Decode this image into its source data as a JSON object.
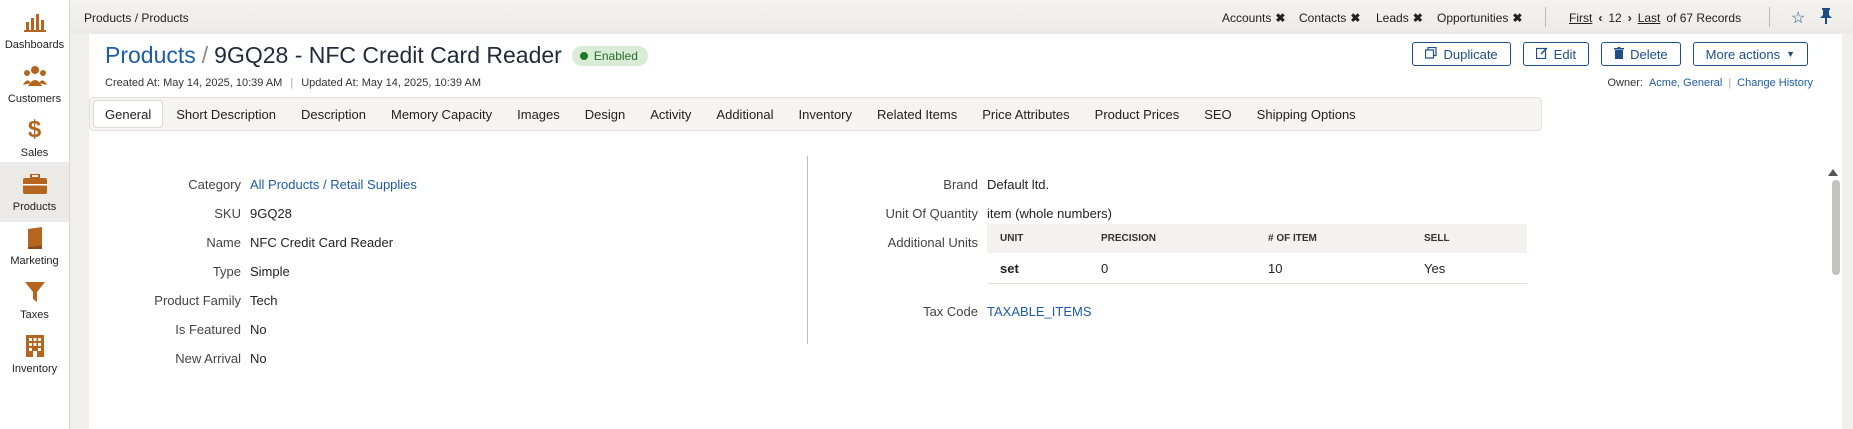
{
  "sidebar": {
    "items": [
      {
        "label": "Dashboards",
        "icon": "bar-chart-icon"
      },
      {
        "label": "Customers",
        "icon": "users-icon"
      },
      {
        "label": "Sales",
        "icon": "dollar-icon"
      },
      {
        "label": "Products",
        "icon": "briefcase-icon"
      },
      {
        "label": "Marketing",
        "icon": "book-icon"
      },
      {
        "label": "Taxes",
        "icon": "filter-icon"
      },
      {
        "label": "Inventory",
        "icon": "building-icon"
      }
    ]
  },
  "topbar": {
    "breadcrumb": "Products / Products",
    "pinned_tabs": [
      "Accounts",
      "Contacts",
      "Leads",
      "Opportunities"
    ],
    "pager": {
      "first": "First",
      "current": "12",
      "last": "Last",
      "total": "of 67 Records"
    }
  },
  "header": {
    "title_link": "Products",
    "title_sep": "/",
    "title": "9GQ28 - NFC Credit Card Reader",
    "status": "Enabled",
    "created": "Created At: May 14, 2025, 10:39 AM",
    "updated": "Updated At: May 14, 2025, 10:39 AM",
    "owner_label": "Owner:",
    "owner_value": "Acme, General",
    "change_history": "Change History"
  },
  "actions": {
    "duplicate": "Duplicate",
    "edit": "Edit",
    "delete": "Delete",
    "more": "More actions"
  },
  "tabs": [
    "General",
    "Short Description",
    "Description",
    "Memory Capacity",
    "Images",
    "Design",
    "Activity",
    "Additional",
    "Inventory",
    "Related Items",
    "Price Attributes",
    "Product Prices",
    "SEO",
    "Shipping Options"
  ],
  "general": {
    "left": [
      {
        "label": "Category",
        "value": "All Products / Retail Supplies"
      },
      {
        "label": "SKU",
        "value": "9GQ28"
      },
      {
        "label": "Name",
        "value": "NFC Credit Card Reader"
      },
      {
        "label": "Type",
        "value": "Simple"
      },
      {
        "label": "Product Family",
        "value": "Tech"
      },
      {
        "label": "Is Featured",
        "value": "No"
      },
      {
        "label": "New Arrival",
        "value": "No"
      }
    ],
    "right": {
      "brand_label": "Brand",
      "brand": "Default ltd.",
      "uoq_label": "Unit Of Quantity",
      "uoq": "item (whole numbers)",
      "additional_units_label": "Additional Units",
      "units_headers": [
        "UNIT",
        "PRECISION",
        "# OF ITEM",
        "SELL"
      ],
      "units_rows": [
        [
          "set",
          "0",
          "10",
          "Yes"
        ]
      ],
      "tax_label": "Tax Code",
      "tax": "TAXABLE_ITEMS"
    }
  },
  "colors": {
    "link": "#1d5ca8",
    "button": "#1d4e87",
    "status_bg": "#d9ecd5",
    "status_dot": "#1f7a2c"
  }
}
